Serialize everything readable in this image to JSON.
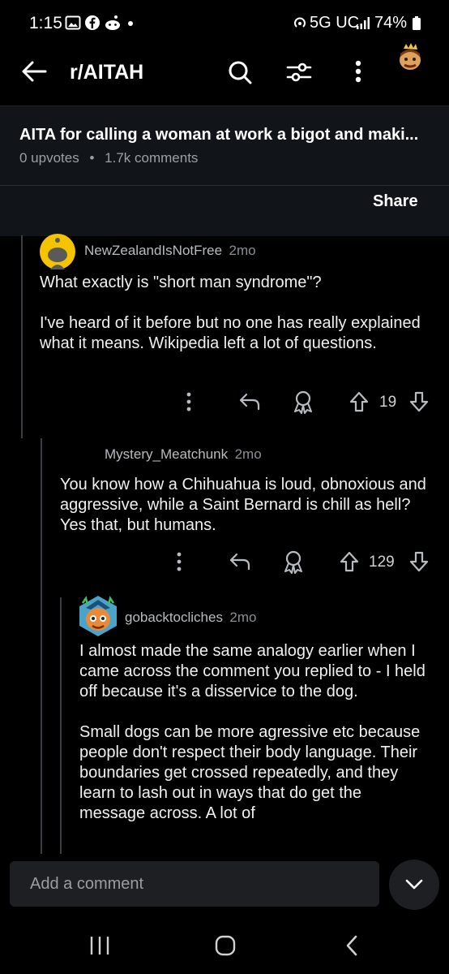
{
  "status": {
    "time": "1:15",
    "network": "5G UC",
    "battery": "74%"
  },
  "header": {
    "subreddit": "r/AITAH"
  },
  "post": {
    "title": "AITA for calling a woman at work a bigot and maki...",
    "upvotes": "0 upvotes",
    "comments": "1.7k comments",
    "share_label": "Share"
  },
  "comments": [
    {
      "author": "NewZealandIsNotFree",
      "age": "2mo",
      "paragraphs": [
        "What exactly is \"short man syndrome\"?",
        "I've heard of it before but no one has really explained what it means.  Wikipedia left a lot of questions."
      ],
      "votes": "19"
    },
    {
      "author": "Mystery_Meatchunk",
      "age": "2mo",
      "paragraphs": [
        "You know how a Chihuahua is loud, obnoxious and aggressive, while a Saint Bernard is chill as hell? Yes that, but humans."
      ],
      "votes": "129"
    },
    {
      "author": "gobacktocliches",
      "age": "2mo",
      "paragraphs": [
        "I almost made the same analogy earlier when I came across the comment you replied to - I held off because it's a disservice to the dog.",
        "Small dogs can be more agressive etc because people don't respect their body language. Their boundaries get crossed repeatedly, and they learn to lash out in ways that do get the message across. A lot of"
      ]
    }
  ],
  "composer": {
    "placeholder": "Add a comment"
  }
}
